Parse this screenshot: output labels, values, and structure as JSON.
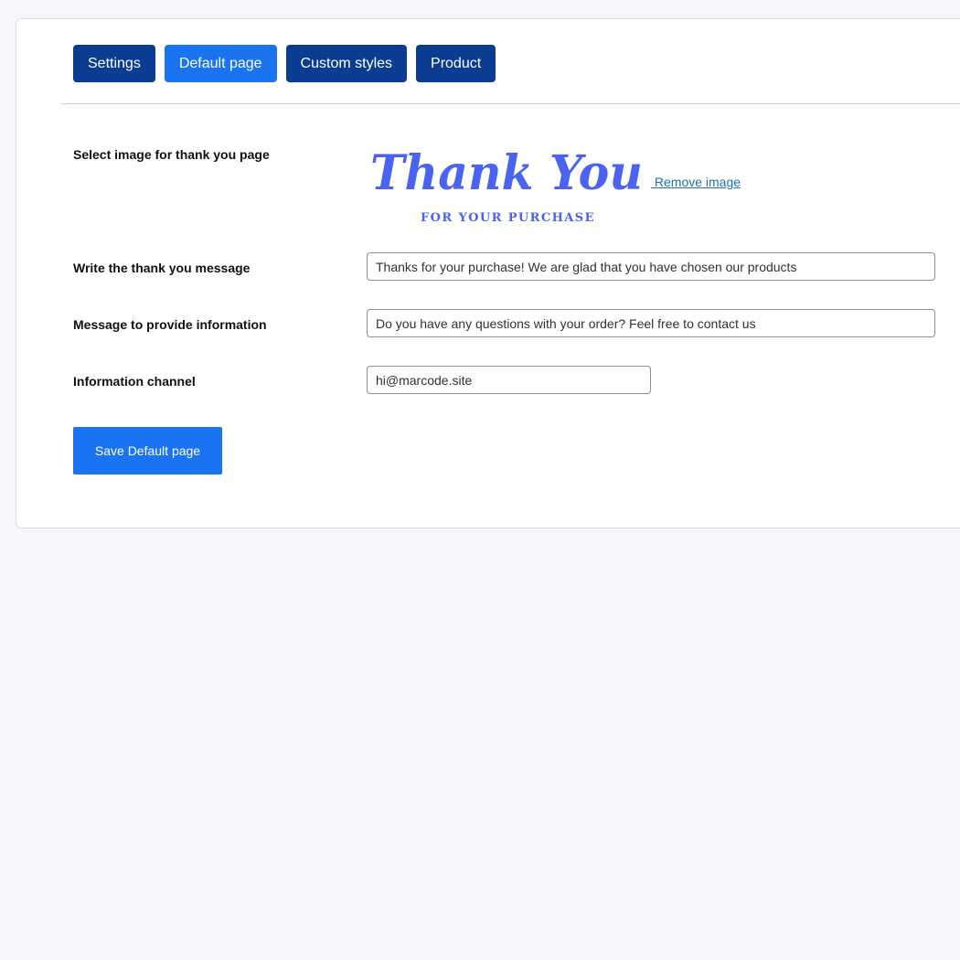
{
  "tabs": [
    {
      "label": "Settings",
      "active": false
    },
    {
      "label": "Default page",
      "active": true
    },
    {
      "label": "Custom styles",
      "active": false
    },
    {
      "label": "Product",
      "active": false
    }
  ],
  "form": {
    "image_label": "Select image for thank you page",
    "image_title": "Thank You",
    "image_subtitle": "FOR YOUR PURCHASE",
    "remove_image_link": " Remove image",
    "message_label": "Write the thank you message",
    "message_value": "Thanks for your purchase! We are glad that you have chosen our products",
    "info_label": "Message to provide information",
    "info_value": "Do you have any questions with your order? Feel free to contact us",
    "channel_label": "Information channel",
    "channel_value": "hi@marcode.site",
    "save_button": "Save Default page"
  },
  "colors": {
    "tab_bg": "#0a3d91",
    "tab_active_bg": "#1a73f0",
    "thank_you_text": "#4a63f0",
    "link": "#2271b1"
  }
}
